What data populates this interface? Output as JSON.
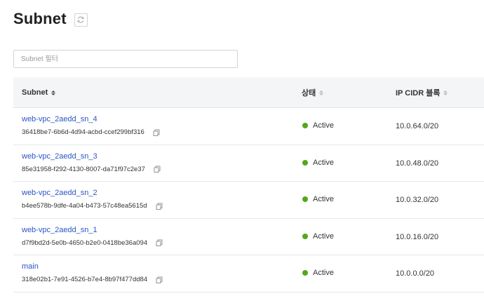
{
  "header": {
    "title": "Subnet"
  },
  "filter": {
    "placeholder": "Subnet 필터",
    "value": ""
  },
  "table": {
    "columns": [
      "Subnet",
      "상태",
      "IP CIDR 블록"
    ],
    "rows": [
      {
        "name": "web-vpc_2aedd_sn_4",
        "id": "36418be7-6b6d-4d94-acbd-ccef299bf316",
        "status": "Active",
        "cidr": "10.0.64.0/20"
      },
      {
        "name": "web-vpc_2aedd_sn_3",
        "id": "85e31958-f292-4130-8007-da71f97c2e37",
        "status": "Active",
        "cidr": "10.0.48.0/20"
      },
      {
        "name": "web-vpc_2aedd_sn_2",
        "id": "b4ee578b-9dfe-4a04-b473-57c48ea5615d",
        "status": "Active",
        "cidr": "10.0.32.0/20"
      },
      {
        "name": "web-vpc_2aedd_sn_1",
        "id": "d7f9bd2d-5e0b-4650-b2e0-0418be36a094",
        "status": "Active",
        "cidr": "10.0.16.0/20"
      },
      {
        "name": "main",
        "id": "318e02b1-7e91-4526-b7e4-8b97f477dd84",
        "status": "Active",
        "cidr": "10.0.0.0/20"
      }
    ]
  },
  "colors": {
    "link": "#2b55c5",
    "status_active": "#52a81c",
    "header_bg": "#f4f5f7"
  },
  "icons": {
    "refresh": "refresh-icon",
    "copy": "copy-icon",
    "sort": "sort-icon"
  }
}
